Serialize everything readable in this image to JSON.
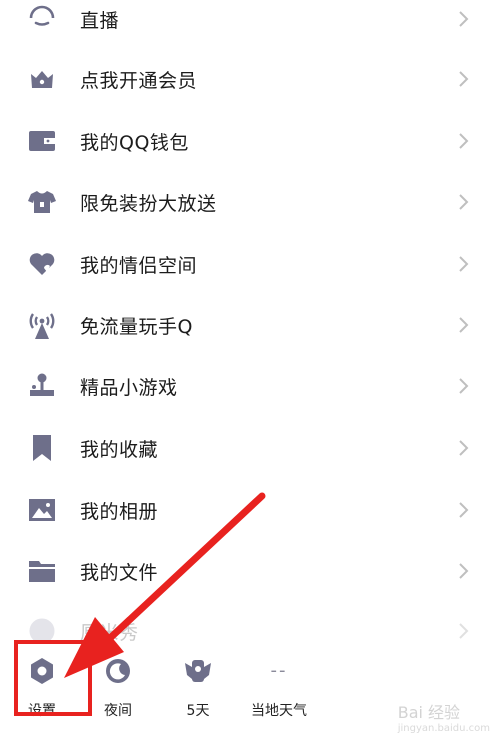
{
  "menu_items": [
    {
      "label": "直播",
      "icon": "live-icon"
    },
    {
      "label": "点我开通会员",
      "icon": "crown-icon"
    },
    {
      "label": "我的QQ钱包",
      "icon": "wallet-icon"
    },
    {
      "label": "限免装扮大放送",
      "icon": "tshirt-icon"
    },
    {
      "label": "我的情侣空间",
      "icon": "heart-icon"
    },
    {
      "label": "免流量玩手Q",
      "icon": "signal-tower-icon"
    },
    {
      "label": "精品小游戏",
      "icon": "joystick-icon"
    },
    {
      "label": "我的收藏",
      "icon": "bookmark-icon"
    },
    {
      "label": "我的相册",
      "icon": "photo-icon"
    },
    {
      "label": "我的文件",
      "icon": "folder-icon"
    },
    {
      "label": "厘米秀",
      "icon": "face-icon"
    }
  ],
  "bottom_bar": {
    "settings": "设置",
    "night": "夜间",
    "days": "5天",
    "weather_value": "--",
    "weather": "当地天气"
  },
  "watermark": {
    "main": "Bai 经验",
    "sub": "jingyan.baidu.com"
  },
  "colors": {
    "icon": "#6e6f8a",
    "annotation": "#e8221f",
    "chevron": "#bfbfbf"
  }
}
